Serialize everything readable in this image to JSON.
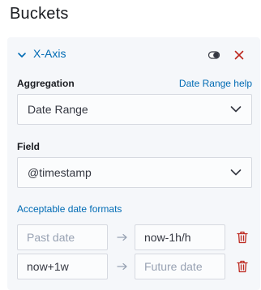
{
  "section": {
    "title": "Buckets"
  },
  "aggregation_panel": {
    "title": "X-Axis",
    "icons": {
      "collapse": "chevron-down-icon",
      "toggle": "toggle-icon",
      "remove": "close-icon"
    },
    "colors": {
      "link": "#006bb4",
      "danger": "#bd271e",
      "panel_background": "#f5f7fa"
    }
  },
  "aggregation": {
    "label": "Aggregation",
    "help_link": "Date Range help",
    "selected": "Date Range"
  },
  "field": {
    "label": "Field",
    "selected": "@timestamp"
  },
  "date_formats_link": "Acceptable date formats",
  "ranges": [
    {
      "from_value": "",
      "from_placeholder": "Past date",
      "to_value": "now-1h/h",
      "to_placeholder": "Future date"
    },
    {
      "from_value": "now+1w",
      "from_placeholder": "Past date",
      "to_value": "",
      "to_placeholder": "Future date"
    }
  ]
}
